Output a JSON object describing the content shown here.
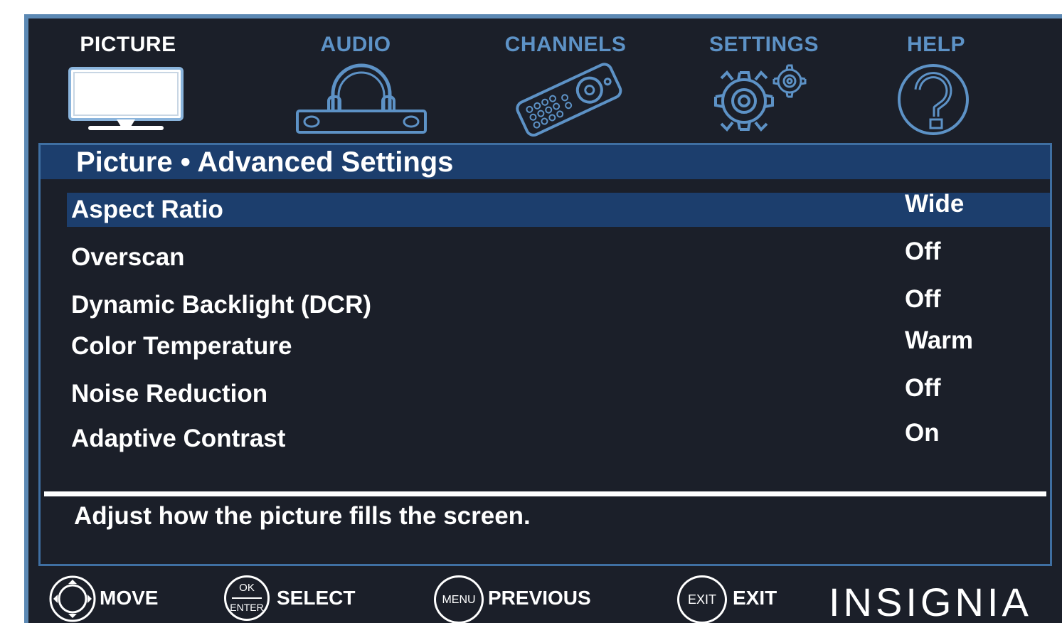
{
  "tabs": [
    {
      "label": "PICTURE",
      "icon": "tv-monitor-icon",
      "active": true
    },
    {
      "label": "AUDIO",
      "icon": "headphones-soundbar-icon",
      "active": false
    },
    {
      "label": "CHANNELS",
      "icon": "remote-control-icon",
      "active": false
    },
    {
      "label": "SETTINGS",
      "icon": "gears-icon",
      "active": false
    },
    {
      "label": "HELP",
      "icon": "question-mark-icon",
      "active": false
    }
  ],
  "panel": {
    "title": "Picture • Advanced Settings",
    "rows": [
      {
        "label": "Aspect Ratio",
        "value": "Wide",
        "selected": true
      },
      {
        "label": "Overscan",
        "value": "Off"
      },
      {
        "label": "Dynamic Backlight (DCR)",
        "value": "Off"
      },
      {
        "label": "Color Temperature",
        "value": "Warm"
      },
      {
        "label": "Noise Reduction",
        "value": "Off"
      },
      {
        "label": "Adaptive Contrast",
        "value": "On"
      }
    ],
    "help_text": "Adjust how the picture fills the screen."
  },
  "footer": {
    "move": {
      "label": "MOVE",
      "icon": "dpad-icon"
    },
    "select": {
      "label": "SELECT",
      "icon": "ok-enter-button-icon",
      "icon_top": "OK",
      "icon_bottom": "ENTER"
    },
    "previous": {
      "label": "PREVIOUS",
      "icon": "menu-button-icon",
      "icon_text": "MENU"
    },
    "exit": {
      "label": "EXIT",
      "icon": "exit-button-icon",
      "icon_text": "EXIT"
    }
  },
  "brand": "INSIGNIA",
  "colors": {
    "background": "#1b1f29",
    "accent": "#5d92c6",
    "selected_bar": "#1c3e6d",
    "border": "#3f6fa2",
    "text": "#ffffff"
  }
}
